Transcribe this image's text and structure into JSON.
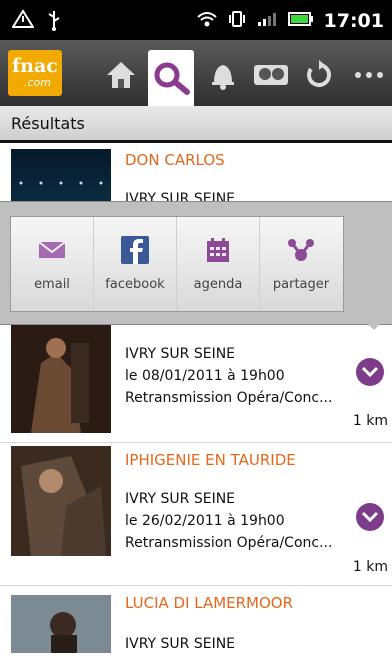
{
  "status_bar": {
    "time": "17:01"
  },
  "toolbar": {
    "logo_text": "fnac",
    "logo_sub": ".com",
    "buttons": [
      "home",
      "search",
      "bell",
      "billet",
      "refresh",
      "more"
    ]
  },
  "results": {
    "title": "Résultats"
  },
  "popup": {
    "items": [
      {
        "label": "email"
      },
      {
        "label": "facebook"
      },
      {
        "label": "agenda"
      },
      {
        "label": "partager"
      }
    ]
  },
  "events": [
    {
      "title": "DON CARLOS",
      "venue": "IVRY SUR SEINE",
      "date": "",
      "category": "",
      "distance": ""
    },
    {
      "title": "",
      "venue": "IVRY SUR SEINE",
      "date": "le 08/01/2011 à 19h00",
      "category": "Retransmission Opéra/Conc...",
      "distance": "1 km"
    },
    {
      "title": "IPHIGENIE EN TAURIDE",
      "venue": "IVRY SUR SEINE",
      "date": "le 26/02/2011 à 19h00",
      "category": "Retransmission Opéra/Conc...",
      "distance": "1 km"
    },
    {
      "title": "LUCIA DI LAMERMOOR",
      "venue": "IVRY SUR SEINE",
      "date": "",
      "category": "",
      "distance": ""
    }
  ],
  "colors": {
    "accent": "#e3681c",
    "purple": "#7d3c8a",
    "logo": "#f2a900"
  }
}
